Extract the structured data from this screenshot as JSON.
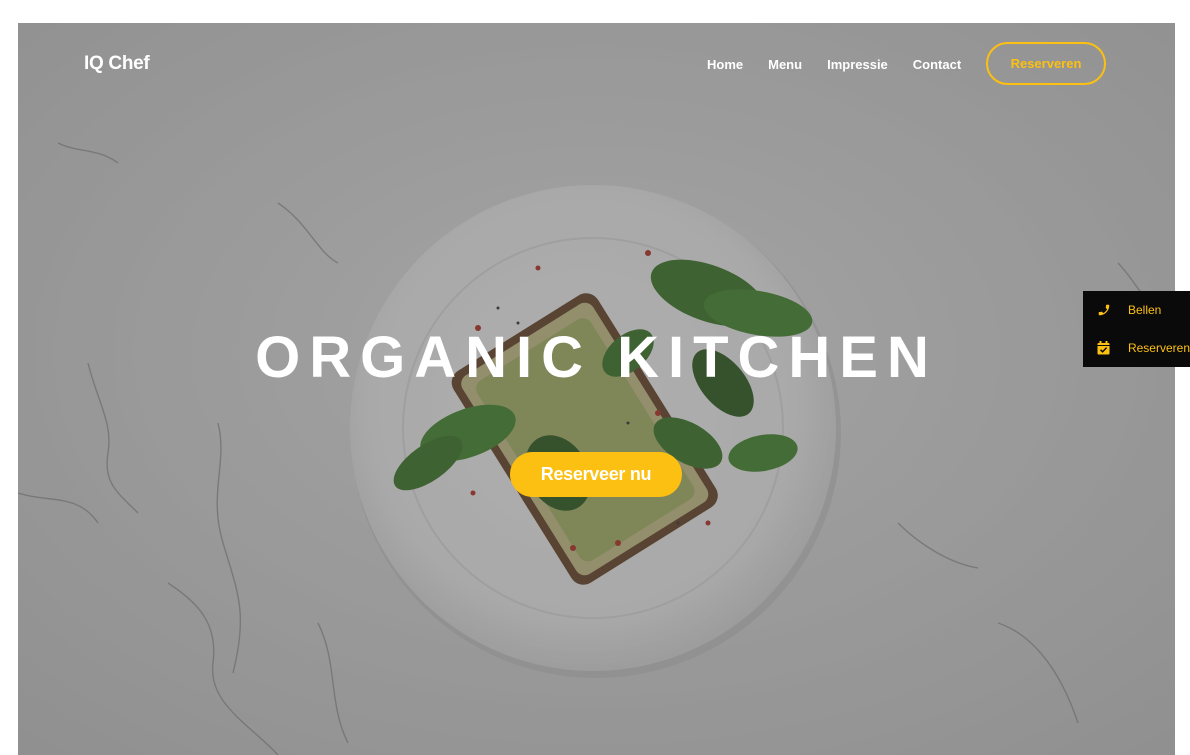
{
  "brand": {
    "name": "IQ Chef"
  },
  "nav": {
    "items": [
      {
        "label": "Home"
      },
      {
        "label": "Menu"
      },
      {
        "label": "Impressie"
      },
      {
        "label": "Contact"
      }
    ],
    "cta_label": "Reserveren"
  },
  "hero": {
    "headline": "ORGANIC KITCHEN",
    "cta_label": "Reserveer nu"
  },
  "side_panel": {
    "items": [
      {
        "label": "Bellen",
        "icon": "phone-icon"
      },
      {
        "label": "Reserveren",
        "icon": "calendar-check-icon"
      }
    ]
  },
  "colors": {
    "accent": "#fcc012",
    "panel": "#0a0a0a"
  }
}
